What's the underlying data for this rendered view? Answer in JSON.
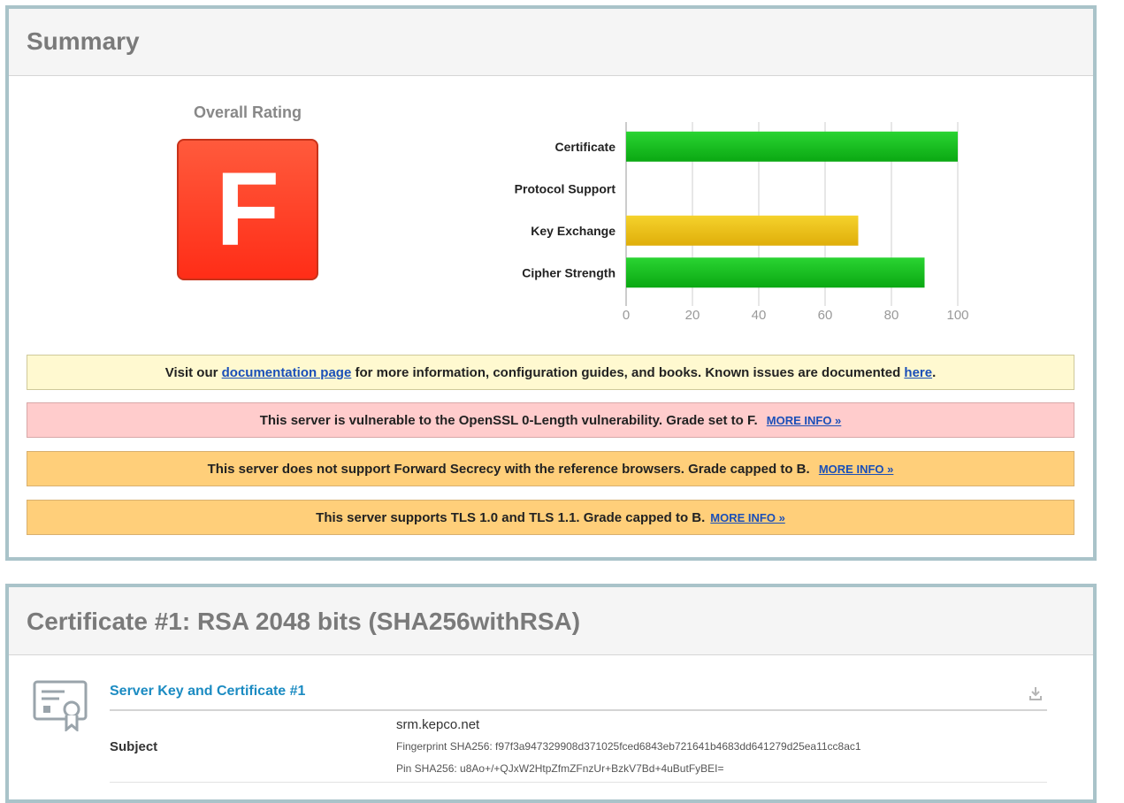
{
  "summary": {
    "title": "Summary",
    "overall_rating_label": "Overall Rating",
    "grade": "F",
    "grade_color": "#ff3b22"
  },
  "chart_data": {
    "type": "bar",
    "orientation": "horizontal",
    "categories": [
      "Certificate",
      "Protocol Support",
      "Key Exchange",
      "Cipher Strength"
    ],
    "values": [
      100,
      0,
      70,
      90
    ],
    "colors": [
      "#14b81e",
      "#14b81e",
      "#e8be14",
      "#14b81e"
    ],
    "xlim": [
      0,
      100
    ],
    "xticks": [
      "0",
      "20",
      "40",
      "60",
      "80",
      "100"
    ],
    "grid": true
  },
  "notices": {
    "docs": {
      "prefix": "Visit our",
      "link1": "documentation page",
      "middle": "for more information, configuration guides, and books. Known issues are documented",
      "link2": "here",
      "suffix": "."
    },
    "openssl": {
      "text": "This server is vulnerable to the OpenSSL 0-Length vulnerability. Grade set to F.",
      "more": "MORE INFO »"
    },
    "fs": {
      "text": "This server does not support Forward Secrecy with the reference browsers. Grade capped to B.",
      "more": "MORE INFO »"
    },
    "tls": {
      "text": "This server supports TLS 1.0 and TLS 1.1. Grade capped to B.",
      "more": "MORE INFO »"
    }
  },
  "certificate": {
    "title": "Certificate #1: RSA 2048 bits (SHA256withRSA)",
    "section_title": "Server Key and Certificate #1",
    "subject_label": "Subject",
    "subject_value": "srm.kepco.net",
    "fingerprint": "Fingerprint SHA256: f97f3a947329908d371025fced6843eb721641b4683dd641279d25ea11cc8ac1",
    "pin": "Pin SHA256: u8Ao+/+QJxW2HtpZfmZFnzUr+BzkV7Bd+4uButFyBEI="
  }
}
